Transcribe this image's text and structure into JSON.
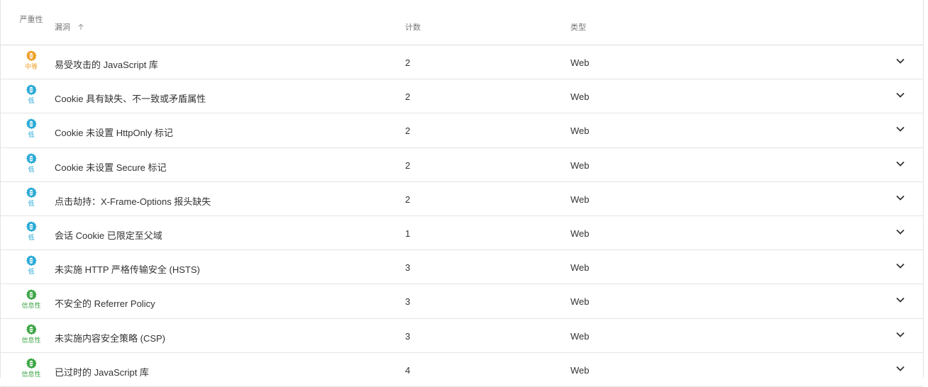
{
  "header": {
    "severity": "严重性",
    "vulnerability": "漏洞",
    "count": "计数",
    "type": "类型"
  },
  "colors": {
    "medium": "#f0a02a",
    "low": "#27a9d6",
    "info": "#3aa544"
  },
  "rows": [
    {
      "severity": "中等",
      "level": "medium",
      "name": "易受攻击的 JavaScript 库",
      "count": "2",
      "type": "Web"
    },
    {
      "severity": "低",
      "level": "low",
      "name": "Cookie 具有缺失、不一致或矛盾属性",
      "count": "2",
      "type": "Web"
    },
    {
      "severity": "低",
      "level": "low",
      "name": "Cookie 未设置 HttpOnly 标记",
      "count": "2",
      "type": "Web"
    },
    {
      "severity": "低",
      "level": "low",
      "name": "Cookie 未设置 Secure 标记",
      "count": "2",
      "type": "Web"
    },
    {
      "severity": "低",
      "level": "low",
      "name": "点击劫持：X-Frame-Options 报头缺失",
      "count": "2",
      "type": "Web"
    },
    {
      "severity": "低",
      "level": "low",
      "name": "会话 Cookie 已限定至父域",
      "count": "1",
      "type": "Web"
    },
    {
      "severity": "低",
      "level": "low",
      "name": "未实施 HTTP 严格传输安全 (HSTS)",
      "count": "3",
      "type": "Web"
    },
    {
      "severity": "信息性",
      "level": "info",
      "name": "不安全的 Referrer Policy",
      "count": "3",
      "type": "Web"
    },
    {
      "severity": "信息性",
      "level": "info",
      "name": "未实施内容安全策略 (CSP)",
      "count": "3",
      "type": "Web"
    },
    {
      "severity": "信息性",
      "level": "info",
      "name": "已过时的 JavaScript 库",
      "count": "4",
      "type": "Web"
    }
  ]
}
